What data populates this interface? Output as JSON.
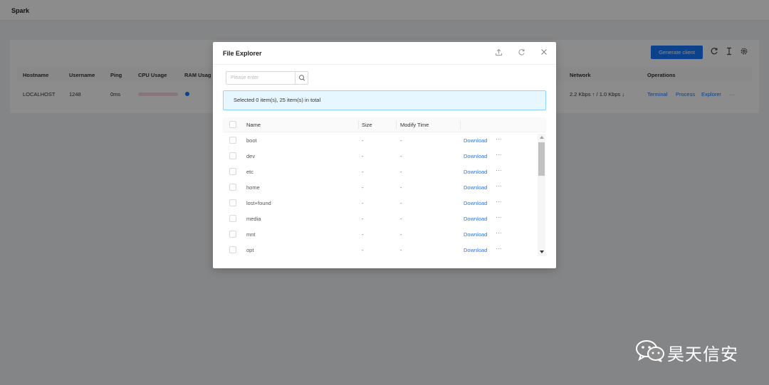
{
  "app": {
    "title": "Spark"
  },
  "toolbar": {
    "generate_label": "Generate client",
    "icons": [
      "refresh-icon",
      "text-cursor-icon",
      "settings-icon"
    ]
  },
  "clients_table": {
    "headers": [
      "Hostname",
      "Username",
      "Ping",
      "CPU Usage",
      "RAM Usag",
      "Network",
      "Operations"
    ],
    "row": {
      "hostname": "LOCALHOST",
      "username": "1248",
      "ping": "0ms",
      "network": "2.2 Kbps ↑ / 1.0 Kbps ↓",
      "ops": {
        "terminal": "Terminal",
        "process": "Process",
        "explorer": "Explorer",
        "more": "···"
      }
    }
  },
  "file_explorer": {
    "title": "File Explorer",
    "search": {
      "placeholder": "Please enter"
    },
    "selection_summary": "Selected 0 item(s), 25 item(s) in total",
    "columns": {
      "name": "Name",
      "size": "Size",
      "modify_time": "Modify Time"
    },
    "files": [
      {
        "name": "boot",
        "size": "-",
        "modified": "-",
        "action": "Download",
        "more": "···"
      },
      {
        "name": "dev",
        "size": "-",
        "modified": "-",
        "action": "Download",
        "more": "···"
      },
      {
        "name": "etc",
        "size": "-",
        "modified": "-",
        "action": "Download",
        "more": "···"
      },
      {
        "name": "home",
        "size": "-",
        "modified": "-",
        "action": "Download",
        "more": "···"
      },
      {
        "name": "lost+found",
        "size": "-",
        "modified": "-",
        "action": "Download",
        "more": "···"
      },
      {
        "name": "media",
        "size": "-",
        "modified": "-",
        "action": "Download",
        "more": "···"
      },
      {
        "name": "mnt",
        "size": "-",
        "modified": "-",
        "action": "Download",
        "more": "···"
      },
      {
        "name": "opt",
        "size": "-",
        "modified": "-",
        "action": "Download",
        "more": "···"
      }
    ]
  },
  "watermark": {
    "text": "昊天信安"
  },
  "colors": {
    "accent": "#1677ff",
    "alert_bg": "#e6f7ff",
    "alert_border": "#91d5ff"
  }
}
